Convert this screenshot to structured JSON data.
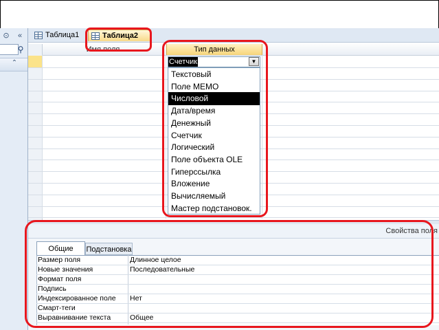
{
  "tabs": [
    {
      "label": "Таблица1",
      "active": false
    },
    {
      "label": "Таблица2",
      "active": true
    }
  ],
  "grid": {
    "col_field_name": "Имя поля",
    "col_data_type": "Тип данных"
  },
  "combo": {
    "value": "Счетчик"
  },
  "dropdown": {
    "options": [
      "Текстовый",
      "Поле MEMO",
      "Числовой",
      "Дата/время",
      "Денежный",
      "Счетчик",
      "Логический",
      "Поле объекта OLE",
      "Гиперссылка",
      "Вложение",
      "Вычисляемый",
      "Мастер подстановок."
    ],
    "highlighted": "Числовой"
  },
  "properties": {
    "title": "Свойства поля",
    "tab_general": "Общие",
    "tab_lookup": "Подстановка",
    "rows": [
      {
        "name": "Размер поля",
        "value": "Длинное целое"
      },
      {
        "name": "Новые значения",
        "value": "Последовательные"
      },
      {
        "name": "Формат поля",
        "value": ""
      },
      {
        "name": "Подпись",
        "value": ""
      },
      {
        "name": "Индексированное поле",
        "value": "Нет"
      },
      {
        "name": "Смарт-теги",
        "value": ""
      },
      {
        "name": "Выравнивание текста",
        "value": "Общее"
      }
    ]
  },
  "annotation_color": "#e8161d",
  "accent": "#f8d98a"
}
